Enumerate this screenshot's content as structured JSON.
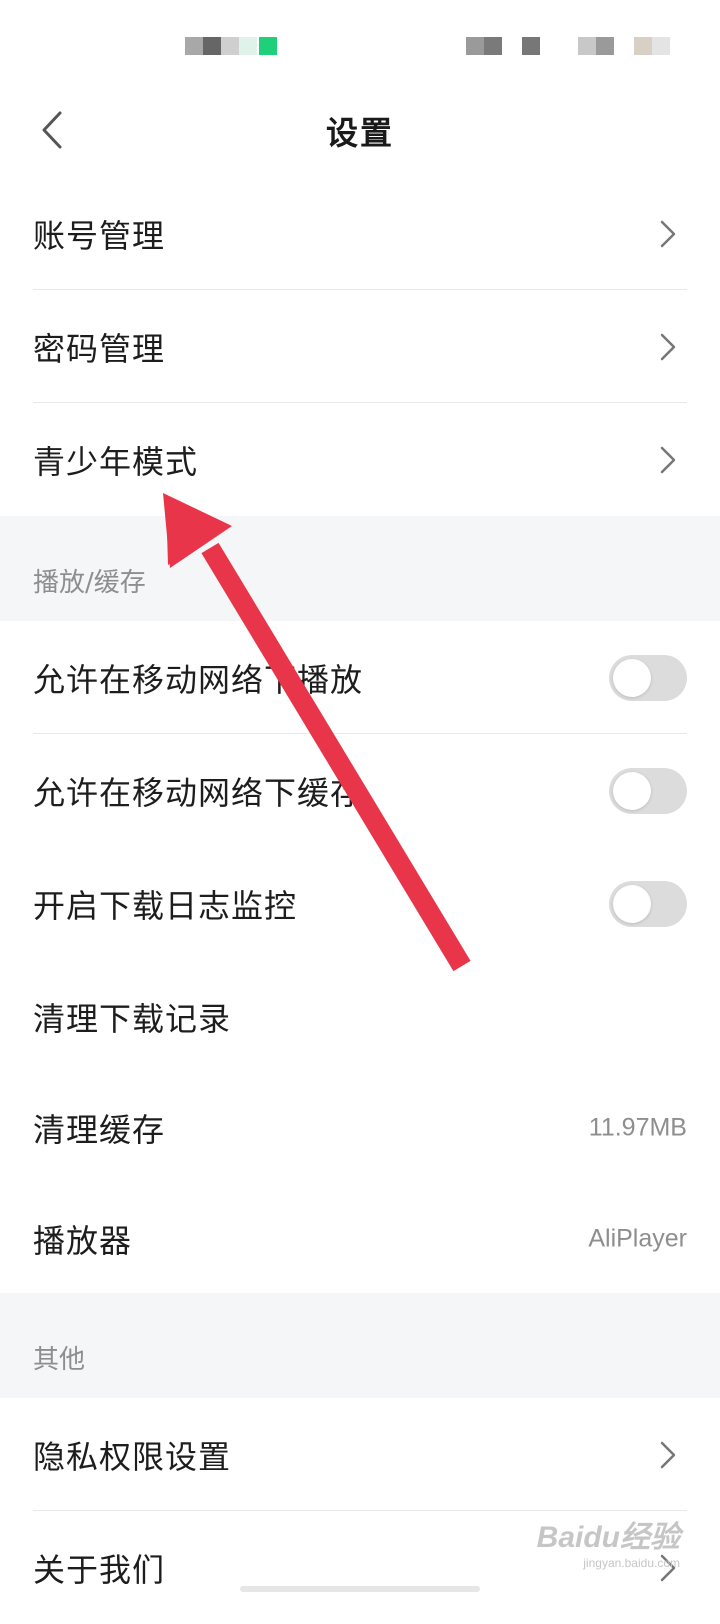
{
  "header": {
    "title": "设置",
    "back_icon": "chevron-left-icon"
  },
  "account_section": {
    "items": [
      {
        "label": "账号管理",
        "icon": "chevron-right-icon"
      },
      {
        "label": "密码管理",
        "icon": "chevron-right-icon"
      },
      {
        "label": "青少年模式",
        "icon": "chevron-right-icon"
      }
    ]
  },
  "playback_section": {
    "title": "播放/缓存",
    "toggles": [
      {
        "label": "允许在移动网络下播放",
        "on": false
      },
      {
        "label": "允许在移动网络下缓存",
        "on": false
      },
      {
        "label": "开启下载日志监控",
        "on": false
      }
    ],
    "clear_download_label": "清理下载记录",
    "clear_cache": {
      "label": "清理缓存",
      "value": "11.97MB"
    },
    "player": {
      "label": "播放器",
      "value": "AliPlayer"
    }
  },
  "other_section": {
    "title": "其他",
    "items": [
      {
        "label": "隐私权限设置",
        "icon": "chevron-right-icon"
      },
      {
        "label": "关于我们",
        "icon": "chevron-right-icon"
      }
    ]
  },
  "watermark": {
    "main": "Baidu经验",
    "sub": "jingyan.baidu.com"
  },
  "colors": {
    "accent_arrow": "#e8354a",
    "section_bg": "#f5f6f8",
    "toggle_off": "#dcdcdc",
    "status_green": "#1fcf7a"
  }
}
